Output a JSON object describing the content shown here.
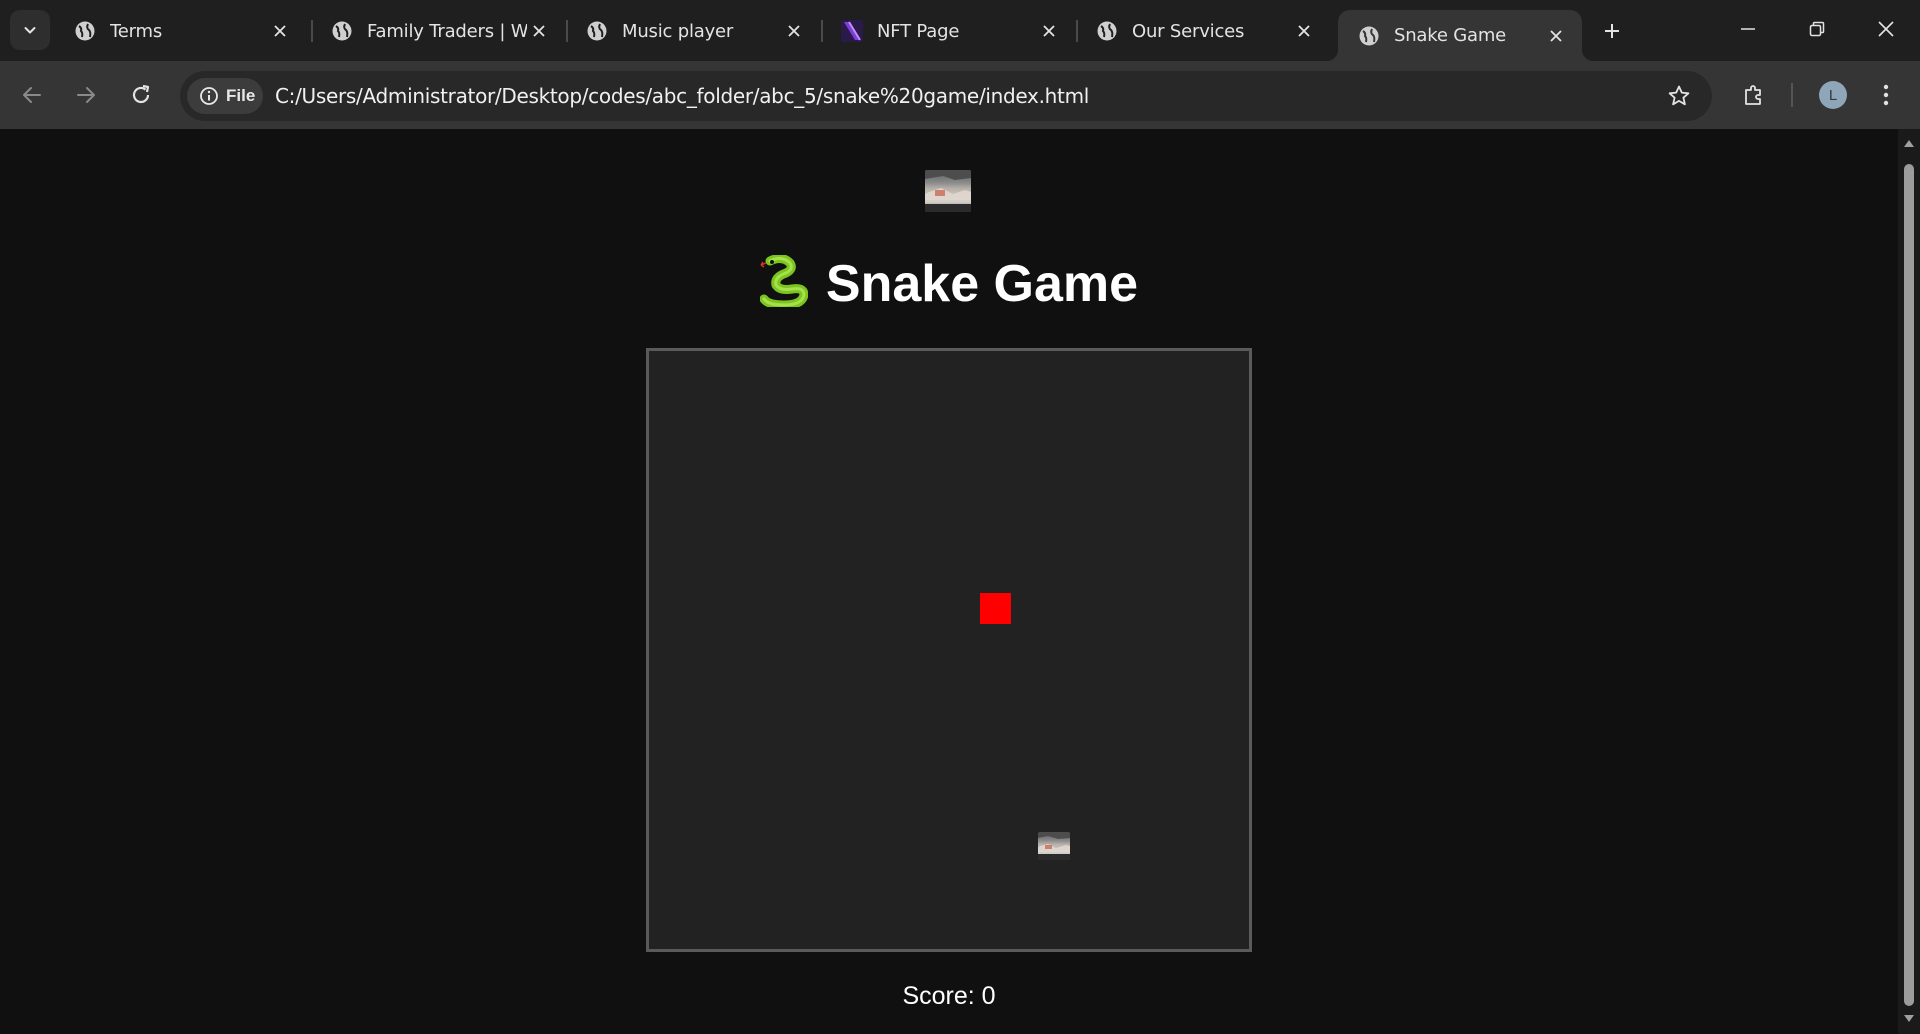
{
  "browser": {
    "tabs": [
      {
        "title": "Terms",
        "icon": "globe-icon",
        "active": false
      },
      {
        "title": "Family Traders | Wi",
        "icon": "globe-icon",
        "active": false
      },
      {
        "title": "Music player",
        "icon": "globe-icon",
        "active": false
      },
      {
        "title": "NFT Page",
        "icon": "nft-favicon-icon",
        "active": false
      },
      {
        "title": "Our Services",
        "icon": "globe-icon",
        "active": false
      },
      {
        "title": "Snake Game",
        "icon": "globe-icon",
        "active": true
      }
    ],
    "address": {
      "chip_label": "File",
      "url": "C:/Users/Administrator/Desktop/codes/abc_folder/abc_5/snake%20game/index.html"
    },
    "profile_initial": "L"
  },
  "page": {
    "title": "Snake Game",
    "title_emoji": "🐍",
    "score_label": "Score: 0",
    "game_state": {
      "score": 0,
      "food_color": "#ff0000"
    }
  },
  "colors": {
    "page_bg": "#101010",
    "board_bg": "#222222",
    "board_border": "#5a5a5a",
    "tabstrip_bg": "#1f1f1f",
    "toolbar_bg": "#353535"
  }
}
